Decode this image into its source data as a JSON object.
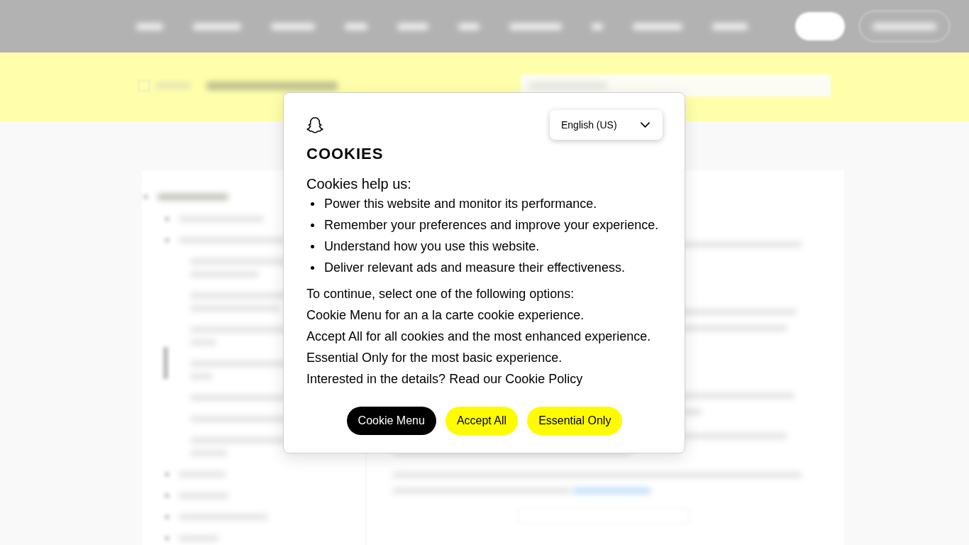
{
  "cookie_dialog": {
    "language_select": {
      "value": "English (US)"
    },
    "title": "COOKIES",
    "intro": "Cookies help us:",
    "purposes": [
      "Power this website and monitor its performance.",
      "Remember your preferences and improve your experience.",
      "Understand how you use this website.",
      "Deliver relevant ads and measure their effectiveness."
    ],
    "options_text": [
      "To continue, select one of the following options:",
      "Cookie Menu for an a la carte cookie experience.",
      "Accept All for all cookies and the most enhanced experience.",
      "Essential Only for the most basic experience.",
      "Interested in the details? Read our Cookie Policy"
    ],
    "buttons": [
      {
        "label": "Cookie Menu",
        "kind": "primary"
      },
      {
        "label": "Accept All",
        "kind": "accent"
      },
      {
        "label": "Essential Only",
        "kind": "accent"
      }
    ]
  }
}
